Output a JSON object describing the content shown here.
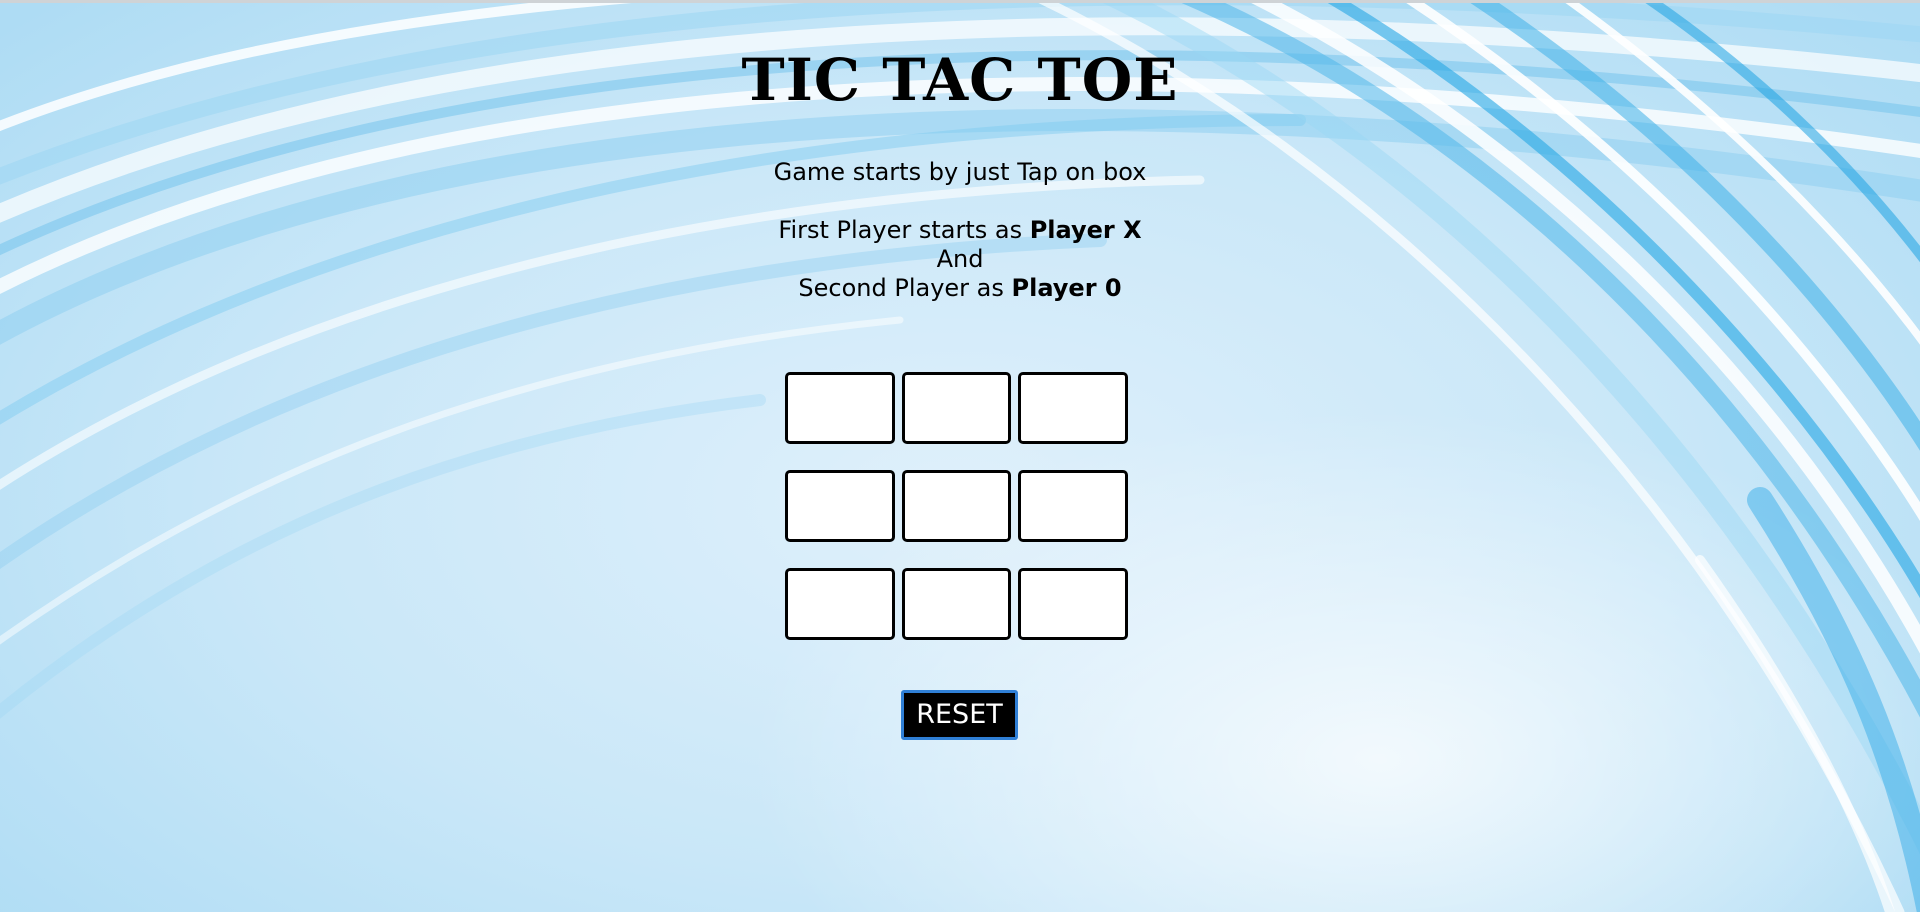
{
  "page": {
    "title": "TIC TAC TOE",
    "instruction": "Game starts by just Tap on box",
    "first_player_prefix": "First Player starts as ",
    "first_player_name": "Player X",
    "and_text": "And",
    "second_player_prefix": "Second Player as ",
    "second_player_name": "Player 0"
  },
  "board": {
    "cells": [
      "",
      "",
      "",
      "",
      "",
      "",
      "",
      "",
      ""
    ]
  },
  "reset": {
    "label": "RESET"
  },
  "colors": {
    "background": "#c9e7f8",
    "cell_fill": "#ffffff",
    "cell_border": "#000000",
    "button_fill": "#000000",
    "button_border": "#2f7fd6",
    "button_text": "#ffffff"
  }
}
